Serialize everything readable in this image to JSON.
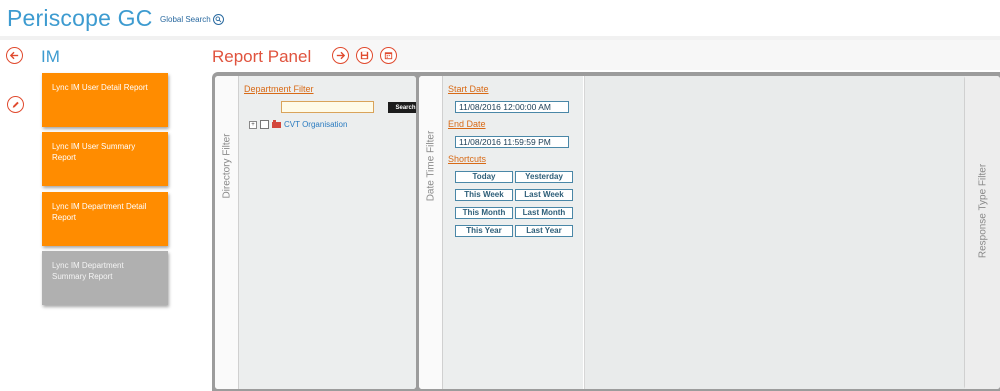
{
  "header": {
    "app_title": "Periscope GC",
    "global_search": "Global Search"
  },
  "module": {
    "title": "IM"
  },
  "reports": [
    {
      "label": "Lync IM User Detail Report",
      "active": true
    },
    {
      "label": "Lync IM User Summary Report",
      "active": true
    },
    {
      "label": "Lync IM Department Detail Report",
      "active": true
    },
    {
      "label": "Lync IM Department Summary Report",
      "active": false
    }
  ],
  "panel": {
    "title": "Report Panel",
    "directory_filter": {
      "tab_label": "Directory Filter",
      "dept_filter_label": "Department Filter",
      "search_value": "",
      "search_button": "Search",
      "tree_item": "CVT Organisation"
    },
    "date_filter": {
      "tab_label": "Date Time Filter",
      "start_label": "Start Date",
      "start_value": "11/08/2016 12:00:00 AM",
      "end_label": "End Date",
      "end_value": "11/08/2016 11:59:59 PM",
      "shortcuts_label": "Shortcuts",
      "shortcuts": [
        "Today",
        "Yesterday",
        "This Week",
        "Last Week",
        "This Month",
        "Last Month",
        "This Year",
        "Last Year"
      ]
    },
    "response_filter": {
      "tab_label": "Response Type Filter"
    }
  },
  "colors": {
    "accent_blue": "#3d9bd0",
    "accent_orange": "#ff8c00",
    "accent_red": "#e04a2e",
    "inactive_gray": "#b0b0b0"
  }
}
